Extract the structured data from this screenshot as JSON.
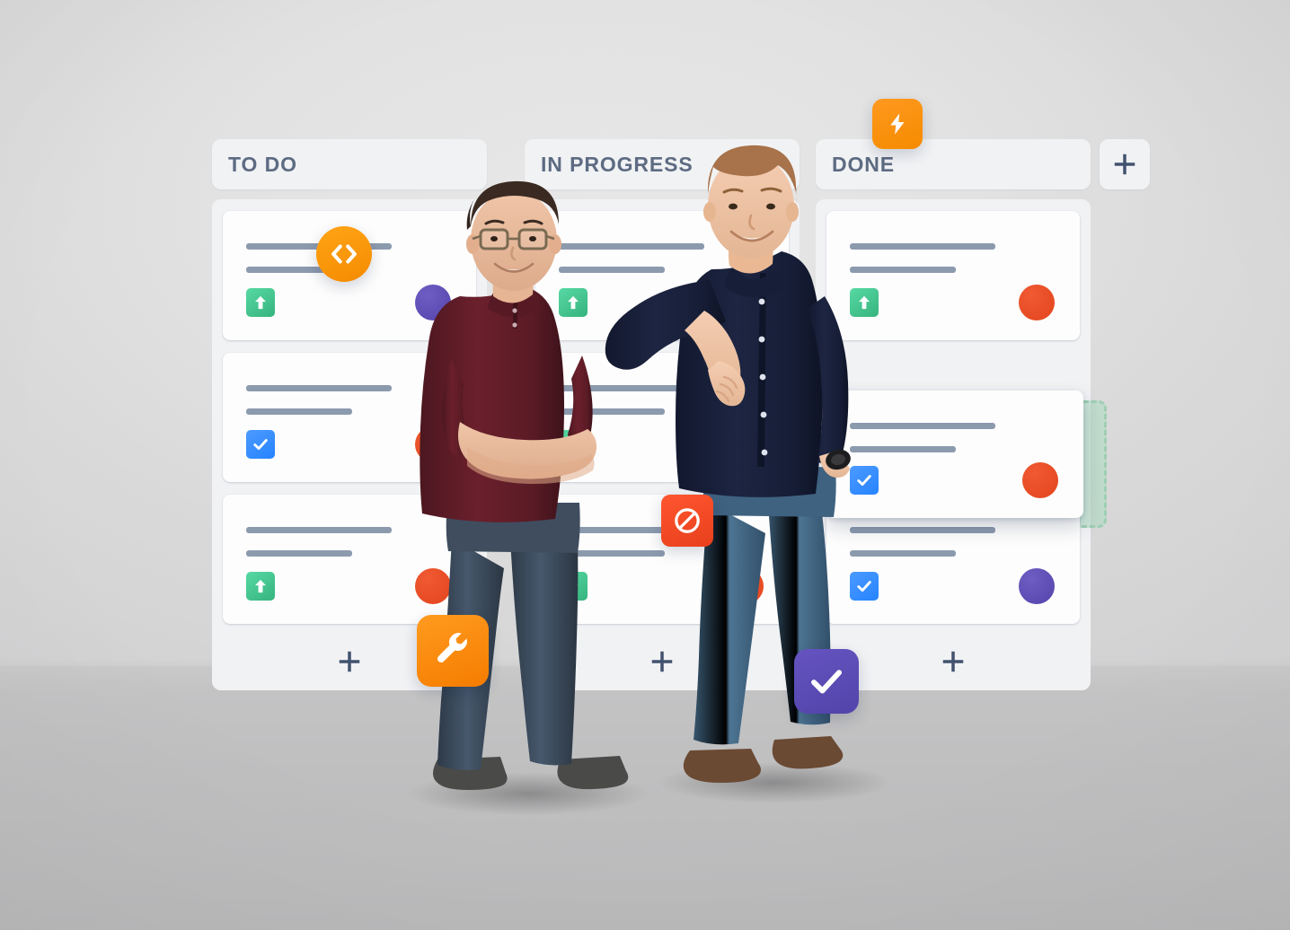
{
  "scene": {
    "title": "Kanban board with two people",
    "background_wall_color": "#e2e2e2",
    "background_floor_color": "#c1c1c2"
  },
  "board": {
    "add_column_button_label": "+",
    "add_column_icon": "plus-icon",
    "columns": [
      {
        "id": "todo",
        "title": "TO DO",
        "add_card_label": "+",
        "add_card_icon": "plus-icon",
        "cards": [
          {
            "id": "todo-card-1",
            "type_icon": "story-arrow-up-icon",
            "type_color": "#36b37e",
            "avatar_icon": "avatar-dot",
            "avatar_color": "#5243aa",
            "line_widths": [
              162,
              118
            ]
          },
          {
            "id": "todo-card-2",
            "type_icon": "task-check-icon",
            "type_color": "#2684ff",
            "avatar_icon": "avatar-dot",
            "avatar_color": "#e2441c",
            "line_widths": [
              162,
              118
            ]
          },
          {
            "id": "todo-card-3",
            "type_icon": "story-arrow-up-icon",
            "type_color": "#36b37e",
            "avatar_icon": "avatar-dot",
            "avatar_color": "#e2441c",
            "line_widths": [
              162,
              118
            ]
          }
        ]
      },
      {
        "id": "in-progress",
        "title": "IN PROGRESS",
        "add_card_label": "+",
        "add_card_icon": "plus-icon",
        "cards": [
          {
            "id": "inprogress-card-1",
            "type_icon": "story-arrow-up-icon",
            "type_color": "#36b37e",
            "avatar_icon": "avatar-dot",
            "avatar_color": "#e2441c",
            "line_widths": [
              162,
              118
            ]
          },
          {
            "id": "inprogress-card-2",
            "type_icon": "story-arrow-up-icon",
            "type_color": "#36b37e",
            "avatar_icon": "avatar-dot",
            "avatar_color": "#e2441c",
            "line_widths": [
              162,
              118
            ]
          },
          {
            "id": "inprogress-card-3",
            "type_icon": "story-arrow-up-icon",
            "type_color": "#36b37e",
            "avatar_icon": "avatar-dot",
            "avatar_color": "#e2441c",
            "line_widths": [
              162,
              118
            ]
          }
        ]
      },
      {
        "id": "done",
        "title": "DONE",
        "add_card_label": "+",
        "add_card_icon": "plus-icon",
        "cards": [
          {
            "id": "done-card-1",
            "type_icon": "story-arrow-up-icon",
            "type_color": "#36b37e",
            "avatar_icon": "avatar-dot",
            "avatar_color": "#e2441c",
            "line_widths": [
              162,
              118
            ]
          },
          {
            "id": "done-card-2-dragging",
            "state": "dragging",
            "type_icon": "task-check-icon",
            "type_color": "#2684ff",
            "avatar_icon": "avatar-dot",
            "avatar_color": "#e2441c",
            "line_widths": [
              162,
              118
            ]
          },
          {
            "id": "done-card-3",
            "type_icon": "task-check-icon",
            "type_color": "#2684ff",
            "avatar_icon": "avatar-dot",
            "avatar_color": "#5243aa",
            "line_widths": [
              162,
              118
            ]
          }
        ],
        "drop_placeholder": {
          "visible": true,
          "fill_color": "#abdbc1",
          "border_color": "#9ecfb5",
          "border_style": "dashed"
        }
      }
    ]
  },
  "floating_badges": [
    {
      "id": "bolt",
      "icon": "lightning-bolt-icon",
      "color": "#f58b00",
      "shape": "rounded-square"
    },
    {
      "id": "code",
      "icon": "code-brackets-icon",
      "color": "#f58b00",
      "shape": "circle"
    },
    {
      "id": "blocked",
      "icon": "blocked-no-entry-icon",
      "color": "#e8401c",
      "shape": "rounded-square"
    },
    {
      "id": "wrench",
      "icon": "wrench-icon",
      "color": "#f57c00",
      "shape": "rounded-square"
    },
    {
      "id": "check",
      "icon": "checkmark-icon",
      "color": "#5243aa",
      "shape": "rounded-square"
    }
  ],
  "people": [
    {
      "id": "person-left",
      "description": "man with glasses, maroon polo shirt, arms crossed, blue jeans"
    },
    {
      "id": "person-right",
      "description": "man in navy button-up shirt, blue jeans, leaning with elbow"
    }
  ],
  "colors": {
    "header_text": "#5d6b82",
    "card_line": "#8c9aae",
    "column_bg": "#f1f2f4",
    "card_bg": "#fdfdfd",
    "plus_icon": "#42526e",
    "green": "#36b37e",
    "blue": "#2684ff",
    "orange": "#f58b00",
    "red": "#e8401c",
    "purple": "#5243aa"
  }
}
